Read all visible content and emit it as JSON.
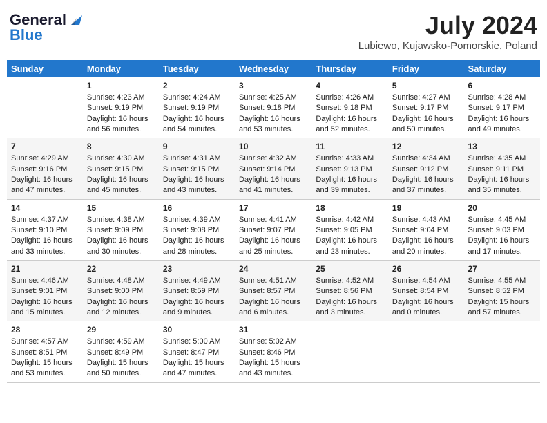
{
  "header": {
    "logo_general": "General",
    "logo_blue": "Blue",
    "month_title": "July 2024",
    "location": "Lubiewo, Kujawsko-Pomorskie, Poland"
  },
  "days_of_week": [
    "Sunday",
    "Monday",
    "Tuesday",
    "Wednesday",
    "Thursday",
    "Friday",
    "Saturday"
  ],
  "weeks": [
    [
      {
        "day": "",
        "content": ""
      },
      {
        "day": "1",
        "content": "Sunrise: 4:23 AM\nSunset: 9:19 PM\nDaylight: 16 hours and 56 minutes."
      },
      {
        "day": "2",
        "content": "Sunrise: 4:24 AM\nSunset: 9:19 PM\nDaylight: 16 hours and 54 minutes."
      },
      {
        "day": "3",
        "content": "Sunrise: 4:25 AM\nSunset: 9:18 PM\nDaylight: 16 hours and 53 minutes."
      },
      {
        "day": "4",
        "content": "Sunrise: 4:26 AM\nSunset: 9:18 PM\nDaylight: 16 hours and 52 minutes."
      },
      {
        "day": "5",
        "content": "Sunrise: 4:27 AM\nSunset: 9:17 PM\nDaylight: 16 hours and 50 minutes."
      },
      {
        "day": "6",
        "content": "Sunrise: 4:28 AM\nSunset: 9:17 PM\nDaylight: 16 hours and 49 minutes."
      }
    ],
    [
      {
        "day": "7",
        "content": "Sunrise: 4:29 AM\nSunset: 9:16 PM\nDaylight: 16 hours and 47 minutes."
      },
      {
        "day": "8",
        "content": "Sunrise: 4:30 AM\nSunset: 9:15 PM\nDaylight: 16 hours and 45 minutes."
      },
      {
        "day": "9",
        "content": "Sunrise: 4:31 AM\nSunset: 9:15 PM\nDaylight: 16 hours and 43 minutes."
      },
      {
        "day": "10",
        "content": "Sunrise: 4:32 AM\nSunset: 9:14 PM\nDaylight: 16 hours and 41 minutes."
      },
      {
        "day": "11",
        "content": "Sunrise: 4:33 AM\nSunset: 9:13 PM\nDaylight: 16 hours and 39 minutes."
      },
      {
        "day": "12",
        "content": "Sunrise: 4:34 AM\nSunset: 9:12 PM\nDaylight: 16 hours and 37 minutes."
      },
      {
        "day": "13",
        "content": "Sunrise: 4:35 AM\nSunset: 9:11 PM\nDaylight: 16 hours and 35 minutes."
      }
    ],
    [
      {
        "day": "14",
        "content": "Sunrise: 4:37 AM\nSunset: 9:10 PM\nDaylight: 16 hours and 33 minutes."
      },
      {
        "day": "15",
        "content": "Sunrise: 4:38 AM\nSunset: 9:09 PM\nDaylight: 16 hours and 30 minutes."
      },
      {
        "day": "16",
        "content": "Sunrise: 4:39 AM\nSunset: 9:08 PM\nDaylight: 16 hours and 28 minutes."
      },
      {
        "day": "17",
        "content": "Sunrise: 4:41 AM\nSunset: 9:07 PM\nDaylight: 16 hours and 25 minutes."
      },
      {
        "day": "18",
        "content": "Sunrise: 4:42 AM\nSunset: 9:05 PM\nDaylight: 16 hours and 23 minutes."
      },
      {
        "day": "19",
        "content": "Sunrise: 4:43 AM\nSunset: 9:04 PM\nDaylight: 16 hours and 20 minutes."
      },
      {
        "day": "20",
        "content": "Sunrise: 4:45 AM\nSunset: 9:03 PM\nDaylight: 16 hours and 17 minutes."
      }
    ],
    [
      {
        "day": "21",
        "content": "Sunrise: 4:46 AM\nSunset: 9:01 PM\nDaylight: 16 hours and 15 minutes."
      },
      {
        "day": "22",
        "content": "Sunrise: 4:48 AM\nSunset: 9:00 PM\nDaylight: 16 hours and 12 minutes."
      },
      {
        "day": "23",
        "content": "Sunrise: 4:49 AM\nSunset: 8:59 PM\nDaylight: 16 hours and 9 minutes."
      },
      {
        "day": "24",
        "content": "Sunrise: 4:51 AM\nSunset: 8:57 PM\nDaylight: 16 hours and 6 minutes."
      },
      {
        "day": "25",
        "content": "Sunrise: 4:52 AM\nSunset: 8:56 PM\nDaylight: 16 hours and 3 minutes."
      },
      {
        "day": "26",
        "content": "Sunrise: 4:54 AM\nSunset: 8:54 PM\nDaylight: 16 hours and 0 minutes."
      },
      {
        "day": "27",
        "content": "Sunrise: 4:55 AM\nSunset: 8:52 PM\nDaylight: 15 hours and 57 minutes."
      }
    ],
    [
      {
        "day": "28",
        "content": "Sunrise: 4:57 AM\nSunset: 8:51 PM\nDaylight: 15 hours and 53 minutes."
      },
      {
        "day": "29",
        "content": "Sunrise: 4:59 AM\nSunset: 8:49 PM\nDaylight: 15 hours and 50 minutes."
      },
      {
        "day": "30",
        "content": "Sunrise: 5:00 AM\nSunset: 8:47 PM\nDaylight: 15 hours and 47 minutes."
      },
      {
        "day": "31",
        "content": "Sunrise: 5:02 AM\nSunset: 8:46 PM\nDaylight: 15 hours and 43 minutes."
      },
      {
        "day": "",
        "content": ""
      },
      {
        "day": "",
        "content": ""
      },
      {
        "day": "",
        "content": ""
      }
    ]
  ]
}
